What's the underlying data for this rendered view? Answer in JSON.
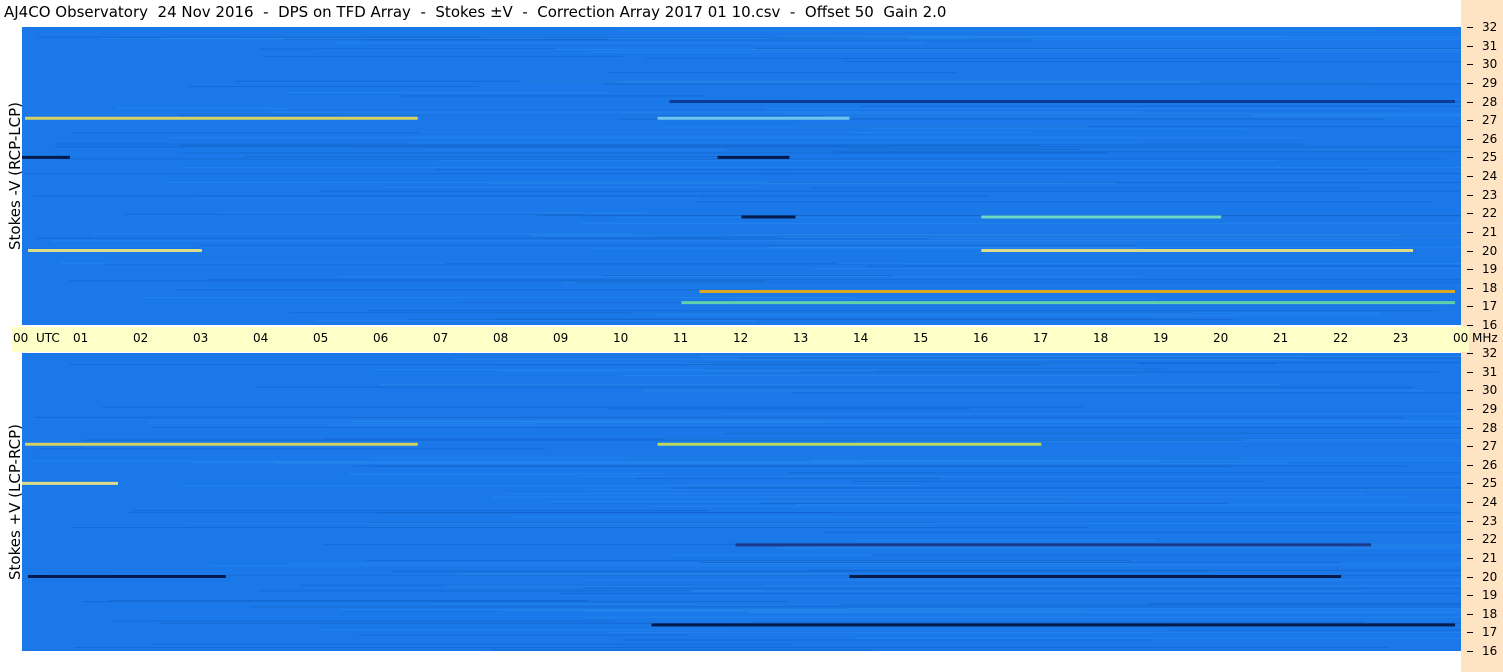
{
  "title": "AJ4CO Observatory  24 Nov 2016  -  DPS on TFD Array  -  Stokes ±V  -  Correction Array 2017 01 10.csv  -  Offset 50  Gain 2.0",
  "chart_data": [
    {
      "type": "heatmap",
      "name": "top",
      "ylabel": "Stokes -V (RCP-LCP)",
      "x_range_hours": [
        0,
        24
      ],
      "y_range_mhz": [
        16,
        32
      ],
      "background_color": "#1a78e8",
      "bright_bands": [
        {
          "freq": 27.1,
          "start": 0.05,
          "end": 6.6,
          "color": "#f5e04a"
        },
        {
          "freq": 27.1,
          "start": 10.6,
          "end": 13.8,
          "color": "#7fd3f0"
        },
        {
          "freq": 28.0,
          "start": 10.8,
          "end": 23.9,
          "color": "#0b2f8a"
        },
        {
          "freq": 20.0,
          "start": 0.1,
          "end": 3.0,
          "color": "#ffef7a"
        },
        {
          "freq": 20.0,
          "start": 16.0,
          "end": 23.2,
          "color": "#ffef7a"
        },
        {
          "freq": 17.8,
          "start": 11.3,
          "end": 23.9,
          "color": "#ffb000"
        },
        {
          "freq": 17.2,
          "start": 11.0,
          "end": 23.9,
          "color": "#6fe0a0"
        },
        {
          "freq": 21.8,
          "start": 16.0,
          "end": 20.0,
          "color": "#7fe8c0"
        },
        {
          "freq": 21.8,
          "start": 12.0,
          "end": 12.9,
          "color": "#000a30"
        },
        {
          "freq": 25.0,
          "start": 0.0,
          "end": 0.8,
          "color": "#000a30"
        },
        {
          "freq": 25.0,
          "start": 11.6,
          "end": 12.8,
          "color": "#000a30"
        }
      ]
    },
    {
      "type": "heatmap",
      "name": "bottom",
      "ylabel": "Stokes +V (LCP-RCP)",
      "x_range_hours": [
        0,
        24
      ],
      "y_range_mhz": [
        16,
        32
      ],
      "background_color": "#1a78e8",
      "bright_bands": [
        {
          "freq": 27.1,
          "start": 0.05,
          "end": 6.6,
          "color": "#f5e04a"
        },
        {
          "freq": 27.1,
          "start": 10.6,
          "end": 17.0,
          "color": "#d6ea4a"
        },
        {
          "freq": 25.0,
          "start": 0.0,
          "end": 1.6,
          "color": "#ffef7a"
        },
        {
          "freq": 20.0,
          "start": 0.1,
          "end": 3.4,
          "color": "#000a30"
        },
        {
          "freq": 20.0,
          "start": 13.8,
          "end": 22.0,
          "color": "#000a30"
        },
        {
          "freq": 17.4,
          "start": 10.5,
          "end": 23.9,
          "color": "#000a30"
        },
        {
          "freq": 21.7,
          "start": 11.9,
          "end": 22.5,
          "color": "#1a2f7a"
        }
      ]
    }
  ],
  "x_axis": {
    "hour_labels": [
      "00",
      "01",
      "02",
      "03",
      "04",
      "05",
      "06",
      "07",
      "08",
      "09",
      "10",
      "11",
      "12",
      "13",
      "14",
      "15",
      "16",
      "17",
      "18",
      "19",
      "20",
      "21",
      "22",
      "23",
      "00"
    ],
    "start_suffix": "UTC",
    "end_suffix": "MHz"
  },
  "y_ticks": [
    "32",
    "31",
    "30",
    "29",
    "28",
    "27",
    "26",
    "25",
    "24",
    "23",
    "22",
    "21",
    "20",
    "19",
    "18",
    "17",
    "16"
  ]
}
